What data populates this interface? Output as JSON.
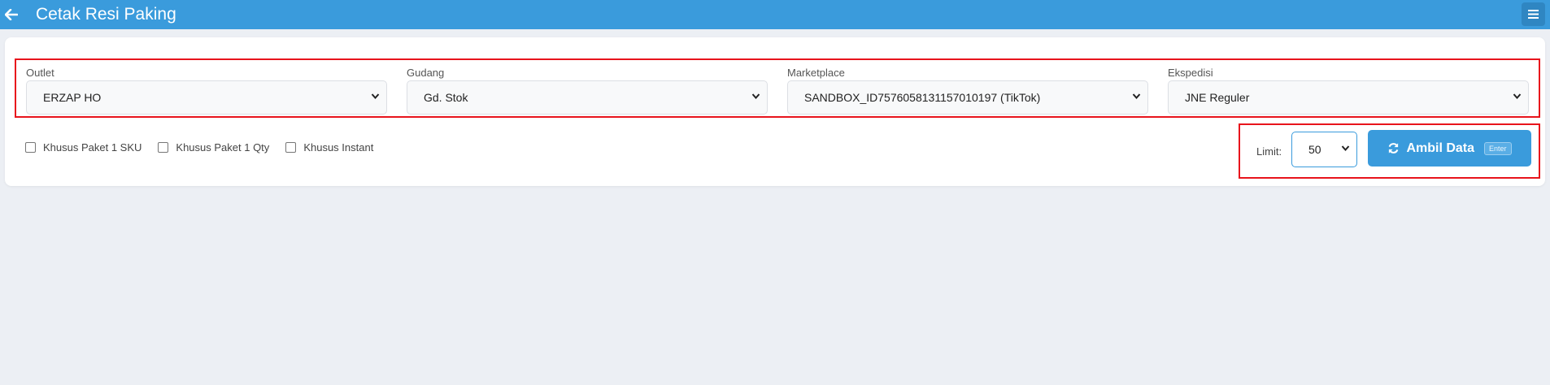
{
  "header": {
    "title": "Cetak Resi Paking",
    "back_icon": "arrow-left-icon",
    "menu_icon": "hamburger-menu-icon"
  },
  "filters": {
    "outlet": {
      "label": "Outlet",
      "value": "ERZAP HO"
    },
    "gudang": {
      "label": "Gudang",
      "value": "Gd. Stok"
    },
    "marketplace": {
      "label": "Marketplace",
      "value": "SANDBOX_ID7576058131157010197 (TikTok)"
    },
    "ekspedisi": {
      "label": "Ekspedisi",
      "value": "JNE Reguler"
    }
  },
  "options": {
    "paket_1_sku": "Khusus Paket 1 SKU",
    "paket_1_qty": "Khusus Paket 1 Qty",
    "instant": "Khusus Instant"
  },
  "actions": {
    "limit_label": "Limit:",
    "limit_value": "50",
    "ambil_label": "Ambil Data",
    "ambil_shortcut": "Enter",
    "ambil_icon": "refresh-icon"
  },
  "colors": {
    "primary": "#3a9bdc",
    "highlight": "#e8141c",
    "background": "#eceff4"
  }
}
